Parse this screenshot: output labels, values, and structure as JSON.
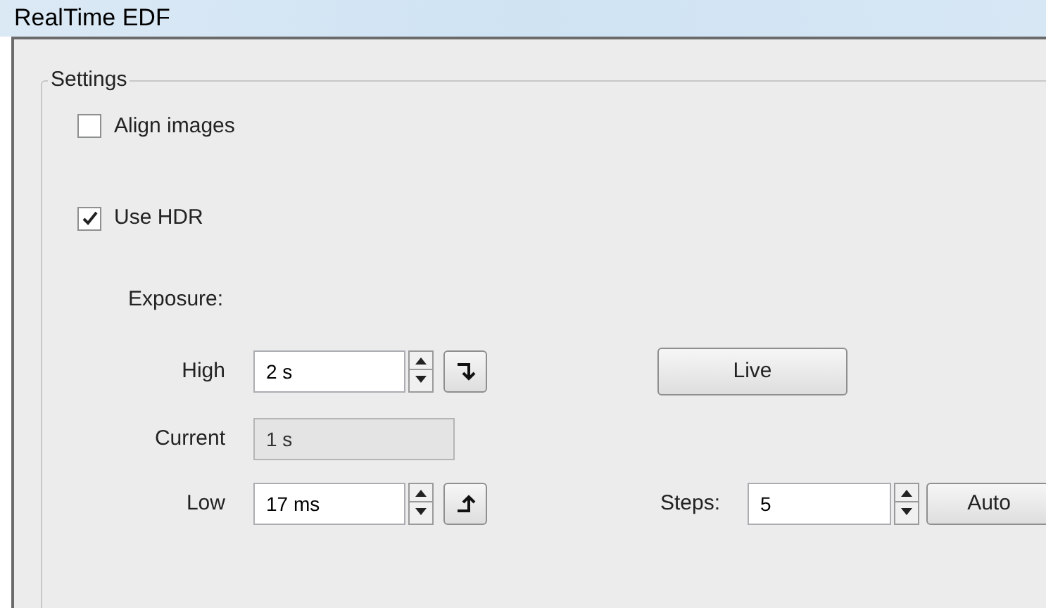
{
  "window": {
    "title": "RealTime EDF"
  },
  "settings": {
    "title": "Settings",
    "checkboxes": [
      {
        "label": "Align images",
        "checked": false
      },
      {
        "label": "Use HDR",
        "checked": true
      }
    ],
    "exposure": {
      "label": "Exposure:",
      "high": {
        "label": "High",
        "value": "2 s"
      },
      "current": {
        "label": "Current",
        "value": "1 s",
        "disabled": true
      },
      "low": {
        "label": "Low",
        "value": "17 ms"
      }
    },
    "live_button": "Live",
    "steps": {
      "label": "Steps:",
      "value": "5"
    },
    "auto_button": "Auto"
  }
}
